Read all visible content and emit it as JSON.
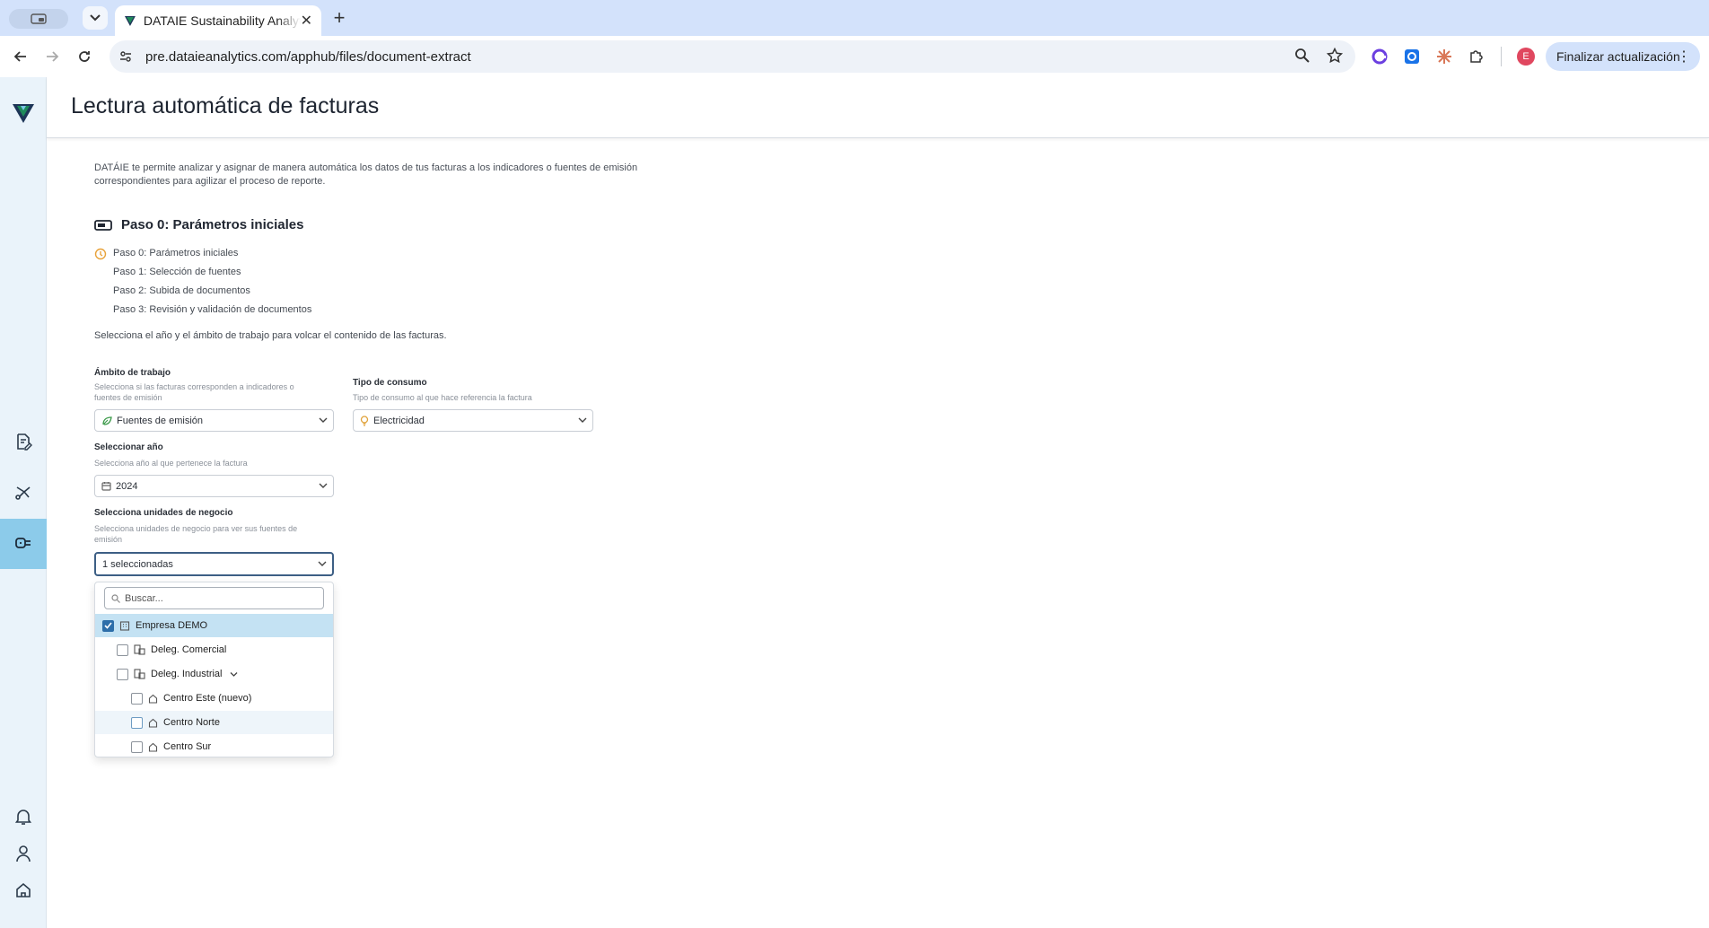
{
  "browser": {
    "tab_title": "DATAIE Sustainability Analytics",
    "url": "pre.dataieanalytics.com/apphub/files/document-extract",
    "profile_initial": "E",
    "update_button": "Finalizar actualización"
  },
  "page": {
    "title": "Lectura automática de facturas",
    "intro": "DATÁIE te permite analizar y asignar de manera automática los datos de tus facturas a los indicadores o fuentes de emisión correspondientes para agilizar el proceso de reporte.",
    "step_heading": "Paso 0: Parámetros iniciales",
    "steps": [
      "Paso 0: Parámetros iniciales",
      "Paso 1: Selección de fuentes",
      "Paso 2: Subida de documentos",
      "Paso 3: Revisión y validación de documentos"
    ],
    "step_hint": "Selecciona el año y el ámbito de trabajo para volcar el contenido de las facturas."
  },
  "form": {
    "ambito": {
      "label": "Ámbito de trabajo",
      "help": "Selecciona si las facturas corresponden a indicadores o fuentes de emisión",
      "value": "Fuentes de emisión"
    },
    "consumo": {
      "label": "Tipo de consumo",
      "help": "Tipo de consumo al que hace referencia la factura",
      "value": "Electricidad"
    },
    "anio": {
      "label": "Seleccionar año",
      "help": "Selecciona año al que pertenece la factura",
      "value": "2024"
    },
    "unidades": {
      "label": "Selecciona unidades de negocio",
      "help": "Selecciona unidades de negocio para ver sus fuentes de emisión",
      "value": "1 seleccionadas"
    }
  },
  "dropdown": {
    "search_placeholder": "Buscar...",
    "items": [
      {
        "label": "Empresa DEMO",
        "checked": true
      },
      {
        "label": "Deleg. Comercial",
        "checked": false
      },
      {
        "label": "Deleg. Industrial",
        "checked": false
      },
      {
        "label": "Centro Este (nuevo)",
        "checked": false
      },
      {
        "label": "Centro Norte",
        "checked": false
      },
      {
        "label": "Centro Sur",
        "checked": false
      }
    ]
  },
  "colors": {
    "accent": "#2d6ea9",
    "sidebar_active": "#8ccbea",
    "logo_green": "#1e8a5a",
    "logo_navy": "#1d3557"
  }
}
